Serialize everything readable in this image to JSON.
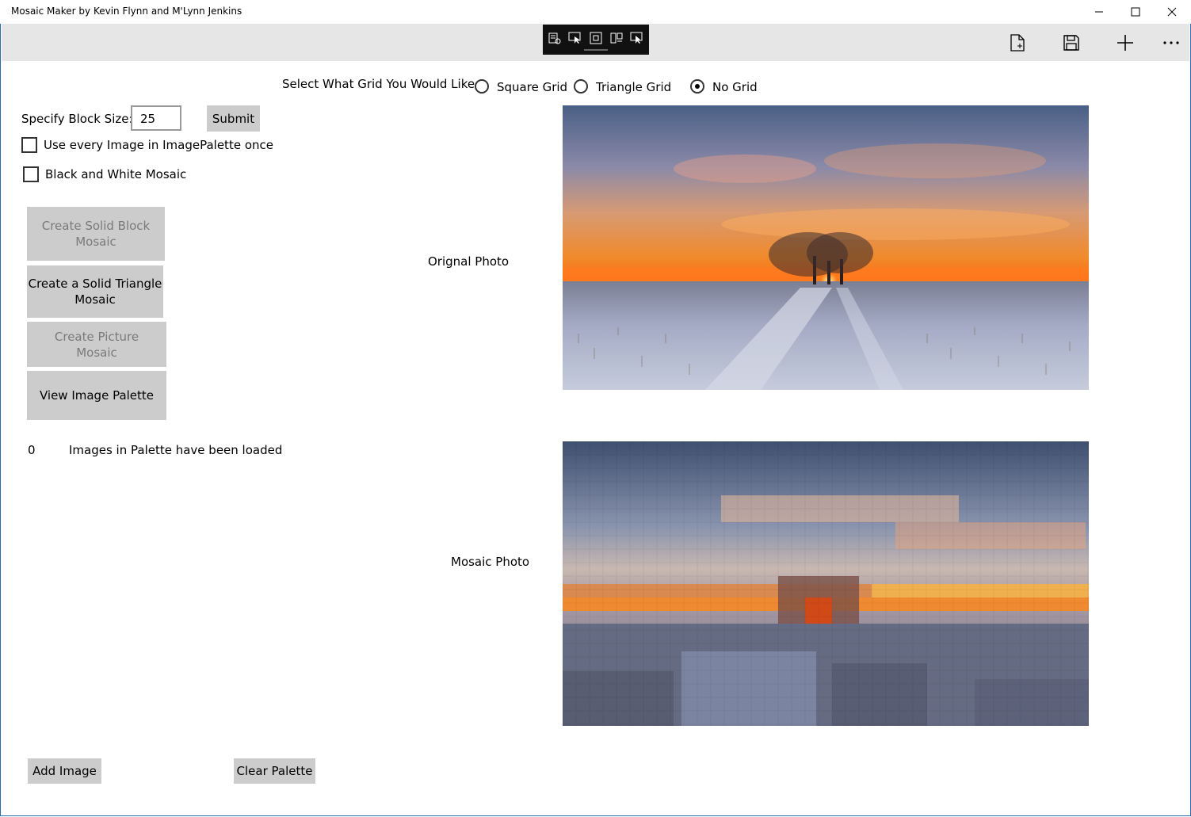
{
  "window": {
    "title": "Mosaic Maker by Kevin Flynn and M'Lynn Jenkins",
    "controls": [
      "minimize-icon",
      "maximize-icon",
      "close-icon"
    ]
  },
  "toolbar": {
    "icons": [
      "new-file-icon",
      "save-icon",
      "add-icon",
      "more-icon"
    ]
  },
  "grid": {
    "prompt": "Select What Grid You Would Like",
    "options": [
      {
        "label": "Square Grid",
        "checked": false
      },
      {
        "label": "Triangle Grid",
        "checked": false
      },
      {
        "label": "No Grid",
        "checked": true
      }
    ]
  },
  "block_size": {
    "label": "Specify Block Size:",
    "value": "25",
    "submit": "Submit"
  },
  "options": {
    "use_every_image": "Use every Image in ImagePalette once",
    "black_white": "Black and White Mosaic"
  },
  "actions": {
    "solid_block": "Create Solid Block\nMosaic",
    "solid_triangle": "Create a Solid Triangle\nMosaic",
    "picture_mosaic": "Create Picture\nMosaic",
    "view_palette": "View Image Palette"
  },
  "palette": {
    "count": "0",
    "status": "Images in Palette have been loaded",
    "add": "Add Image",
    "clear": "Clear Palette"
  },
  "photos": {
    "original_label": "Orignal Photo",
    "mosaic_label": "Mosaic Photo"
  }
}
